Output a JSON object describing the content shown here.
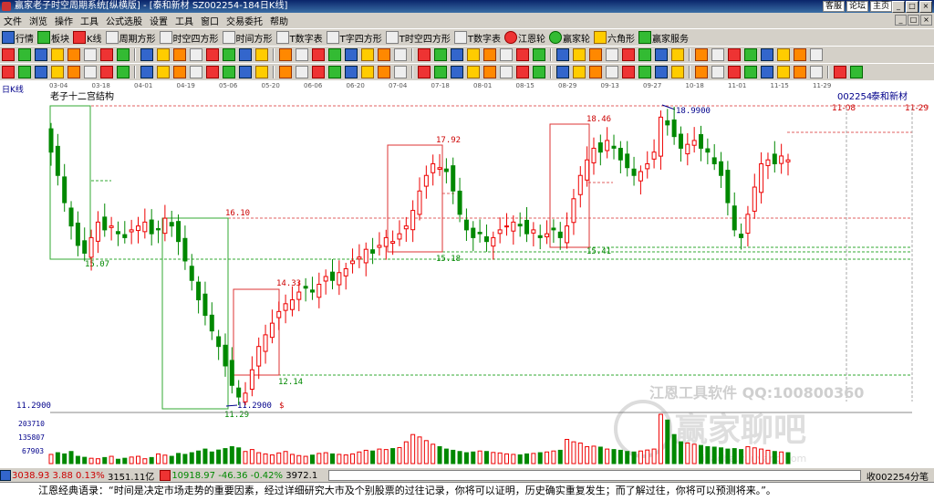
{
  "window": {
    "title": "赢家老子时空周期系统[纵横版] - [泰和新材  SZ002254-184日K线]",
    "links": [
      "客服",
      "论坛",
      "主页"
    ],
    "controls": [
      "_",
      "□",
      "×"
    ]
  },
  "menu": [
    "文件",
    "浏览",
    "操作",
    "工具",
    "公式选股",
    "设置",
    "工具",
    "窗口",
    "交易委托",
    "帮助"
  ],
  "toolbar1": [
    "行情",
    "板块",
    "K线",
    "周期方形",
    "时空四方形",
    "时间方形",
    "T数字表",
    "T字四方形",
    "T时空四方形",
    "T数字表",
    "江恩轮",
    "赢家轮",
    "六角形",
    "赢家服务"
  ],
  "chart": {
    "panel_label": "日K线",
    "study_label": "老子十二宫结构",
    "stock_code": "002254",
    "stock_name": "泰和新材",
    "date_ticks": [
      "03-04",
      "03-18",
      "04-01",
      "04-19",
      "05-06",
      "05-20",
      "06-06",
      "06-20",
      "07-04",
      "07-18",
      "08-01",
      "08-15",
      "08-29",
      "09-13",
      "09-27",
      "10-18",
      "11-01",
      "11-15",
      "11-29"
    ],
    "top_right_dates": [
      "11-08",
      "11-29"
    ],
    "level_labels": [
      "16.10",
      "15.07",
      "17.92",
      "15.18",
      "18.46",
      "15.41",
      "18.9900",
      "14.33",
      "12.14",
      "11.2900",
      "11.29"
    ],
    "dollar_mark": "$",
    "left_price": "11.2900",
    "vol_ticks": [
      "203710",
      "135807",
      "67903"
    ],
    "watermark_tool": "江恩工具软件  QQ:100800360",
    "watermark_forum": "赢家聊吧",
    "watermark_url": "ijiaoba.yanyang.com"
  },
  "chart_data": {
    "type": "candlestick",
    "title": "泰和新材 002254 日K线",
    "price_range": [
      11.29,
      18.99
    ],
    "volume_range": [
      0,
      203710
    ],
    "annotated_levels": [
      {
        "label": "16.10",
        "value": 16.1
      },
      {
        "label": "15.07",
        "value": 15.07
      },
      {
        "label": "17.92",
        "value": 17.92
      },
      {
        "label": "15.18",
        "value": 15.18
      },
      {
        "label": "18.46",
        "value": 18.46
      },
      {
        "label": "15.41",
        "value": 15.41
      },
      {
        "label": "18.9900",
        "value": 18.99
      },
      {
        "label": "14.33",
        "value": 14.33
      },
      {
        "label": "12.14",
        "value": 12.14
      },
      {
        "label": "11.2900",
        "value": 11.29
      }
    ],
    "close_series": [
      17.8,
      17.2,
      16.5,
      15.9,
      15.4,
      15.2,
      15.6,
      16.0,
      15.8,
      15.9,
      15.7,
      15.6,
      15.8,
      15.9,
      16.0,
      15.7,
      15.8,
      16.1,
      15.9,
      15.5,
      15.0,
      14.5,
      14.0,
      13.6,
      13.2,
      12.8,
      12.3,
      11.8,
      11.5,
      11.6,
      12.2,
      12.8,
      13.1,
      13.4,
      13.7,
      13.9,
      14.0,
      14.2,
      14.3,
      14.2,
      14.4,
      14.6,
      14.5,
      14.7,
      14.8,
      15.0,
      15.1,
      15.3,
      15.2,
      15.4,
      15.6,
      15.5,
      15.7,
      15.9,
      16.3,
      16.8,
      17.2,
      17.5,
      17.4,
      17.3,
      16.8,
      16.2,
      15.8,
      15.6,
      15.7,
      15.5,
      15.6,
      15.8,
      15.9,
      16.0,
      15.9,
      15.7,
      15.8,
      15.6,
      15.7,
      15.8,
      15.6,
      15.9,
      16.6,
      17.2,
      17.6,
      17.9,
      17.8,
      18.1,
      17.9,
      17.6,
      17.4,
      17.2,
      17.3,
      17.5,
      17.8,
      18.7,
      18.5,
      18.2,
      17.9,
      18.0,
      18.1,
      17.9,
      17.8,
      17.5,
      17.2,
      16.5,
      15.8,
      15.6,
      16.2,
      16.9,
      17.5,
      17.6,
      17.5,
      17.7,
      17.6
    ],
    "volume_series": [
      38000,
      45000,
      40000,
      50000,
      30000,
      26000,
      22000,
      20000,
      25000,
      30000,
      18000,
      22000,
      27000,
      30000,
      20000,
      25000,
      40000,
      35000,
      30000,
      42000,
      38000,
      45000,
      52000,
      60000,
      48000,
      56000,
      62000,
      70000,
      65000,
      50000,
      58000,
      45000,
      40000,
      36000,
      44000,
      50000,
      38000,
      33000,
      30000,
      35000,
      42000,
      45000,
      40000,
      38000,
      36000,
      40000,
      48000,
      55000,
      52000,
      60000,
      58000,
      62000,
      66000,
      90000,
      120000,
      110000,
      95000,
      80000,
      70000,
      60000,
      55000,
      50000,
      45000,
      48000,
      52000,
      50000,
      46000,
      44000,
      40000,
      38000,
      36000,
      40000,
      42000,
      45000,
      48000,
      52000,
      55000,
      100000,
      90000,
      85000,
      70000,
      72000,
      68000,
      60000,
      58000,
      55000,
      50000,
      48000,
      52000,
      56000,
      60000,
      203710,
      180000,
      120000,
      90000,
      85000,
      80000,
      75000,
      70000,
      68000,
      65000,
      60000,
      62000,
      58000,
      70000,
      65000,
      60000,
      55000,
      50000,
      48000,
      45000
    ]
  },
  "status": {
    "sh_index": "3038.93",
    "sh_change": "3.88 0.13%",
    "sh_amount": "3151.11亿",
    "sz_index": "10918.97",
    "sz_change": "-46.36 -0.42%",
    "sz_amount": "3972.1",
    "right_text": "收002254分笔"
  },
  "quote": "江恩经典语录：“时间是决定市场走势的重要因素，经过详细研究大市及个别股票的过往记录，你将可以证明，历史确实重复发生；而了解过往，你将可以预测将来。”。"
}
